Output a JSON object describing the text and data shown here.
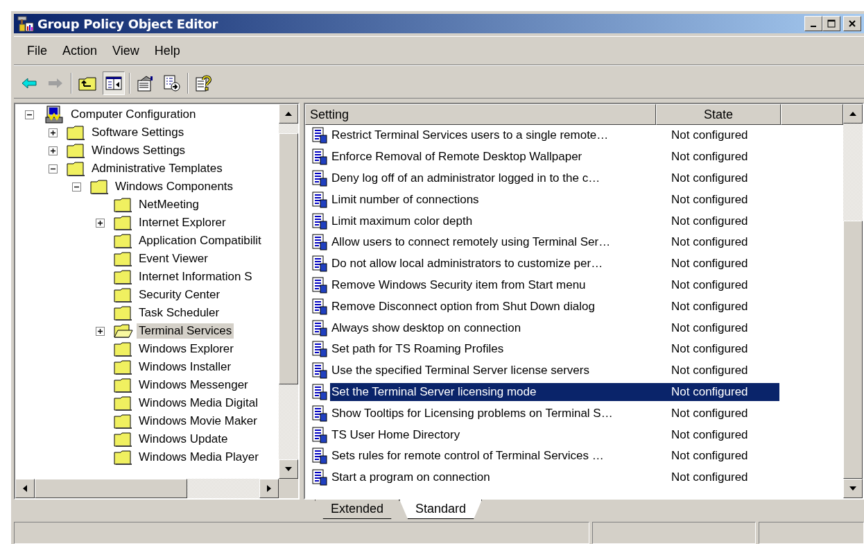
{
  "window": {
    "title": "Group Policy Object Editor"
  },
  "menu": [
    "File",
    "Action",
    "View",
    "Help"
  ],
  "tree": [
    {
      "label": "Computer Configuration",
      "kind": "computer",
      "expanded": true,
      "selected": false,
      "children": [
        {
          "label": "Software Settings",
          "kind": "folder",
          "expanded": false,
          "selected": false
        },
        {
          "label": "Windows Settings",
          "kind": "folder",
          "expanded": false,
          "selected": false
        },
        {
          "label": "Administrative Templates",
          "kind": "folder",
          "expanded": true,
          "selected": false,
          "children": [
            {
              "label": "Windows Components",
              "kind": "folder",
              "expanded": true,
              "selected": false,
              "children": [
                {
                  "label": "NetMeeting",
                  "kind": "folder",
                  "selected": false
                },
                {
                  "label": "Internet Explorer",
                  "kind": "folder",
                  "expanded": false,
                  "selected": false
                },
                {
                  "label": "Application Compatibilit",
                  "kind": "folder",
                  "selected": false
                },
                {
                  "label": "Event Viewer",
                  "kind": "folder",
                  "selected": false
                },
                {
                  "label": "Internet Information S",
                  "kind": "folder",
                  "selected": false
                },
                {
                  "label": "Security Center",
                  "kind": "folder",
                  "selected": false
                },
                {
                  "label": "Task Scheduler",
                  "kind": "folder",
                  "selected": false
                },
                {
                  "label": "Terminal Services",
                  "kind": "folder",
                  "expanded": false,
                  "selected": true
                },
                {
                  "label": "Windows Explorer",
                  "kind": "folder",
                  "selected": false
                },
                {
                  "label": "Windows Installer",
                  "kind": "folder",
                  "selected": false
                },
                {
                  "label": "Windows Messenger",
                  "kind": "folder",
                  "selected": false
                },
                {
                  "label": "Windows Media Digital",
                  "kind": "folder",
                  "selected": false
                },
                {
                  "label": "Windows Movie Maker",
                  "kind": "folder",
                  "selected": false
                },
                {
                  "label": "Windows Update",
                  "kind": "folder",
                  "selected": false
                },
                {
                  "label": "Windows Media Player",
                  "kind": "folder",
                  "selected": false
                }
              ]
            }
          ]
        }
      ]
    }
  ],
  "table": {
    "columns": [
      "Setting",
      "State"
    ],
    "rows": [
      {
        "setting": "Restrict Terminal Services users to a single remote…",
        "state": "Not configured",
        "selected": false
      },
      {
        "setting": "Enforce Removal of Remote Desktop Wallpaper",
        "state": "Not configured",
        "selected": false
      },
      {
        "setting": "Deny log off of an administrator logged in to the c…",
        "state": "Not configured",
        "selected": false
      },
      {
        "setting": "Limit number of connections",
        "state": "Not configured",
        "selected": false
      },
      {
        "setting": "Limit maximum color depth",
        "state": "Not configured",
        "selected": false
      },
      {
        "setting": "Allow users to connect remotely using Terminal Ser…",
        "state": "Not configured",
        "selected": false
      },
      {
        "setting": "Do not allow local administrators to customize per…",
        "state": "Not configured",
        "selected": false
      },
      {
        "setting": "Remove Windows Security item from Start menu",
        "state": "Not configured",
        "selected": false
      },
      {
        "setting": "Remove Disconnect option from Shut Down dialog",
        "state": "Not configured",
        "selected": false
      },
      {
        "setting": "Always show desktop on connection",
        "state": "Not configured",
        "selected": false
      },
      {
        "setting": "Set path for TS Roaming Profiles",
        "state": "Not configured",
        "selected": false
      },
      {
        "setting": "Use the specified Terminal Server license servers",
        "state": "Not configured",
        "selected": false
      },
      {
        "setting": "Set the Terminal Server licensing mode",
        "state": "Not configured",
        "selected": true
      },
      {
        "setting": "Show Tooltips for Licensing problems on Terminal S…",
        "state": "Not configured",
        "selected": false
      },
      {
        "setting": "TS User Home Directory",
        "state": "Not configured",
        "selected": false
      },
      {
        "setting": "Sets rules for remote control of Terminal Services …",
        "state": "Not configured",
        "selected": false
      },
      {
        "setting": "Start a program on connection",
        "state": "Not configured",
        "selected": false
      }
    ]
  },
  "view_tabs": [
    {
      "label": "Extended",
      "selected": false
    },
    {
      "label": "Standard",
      "selected": true
    }
  ]
}
